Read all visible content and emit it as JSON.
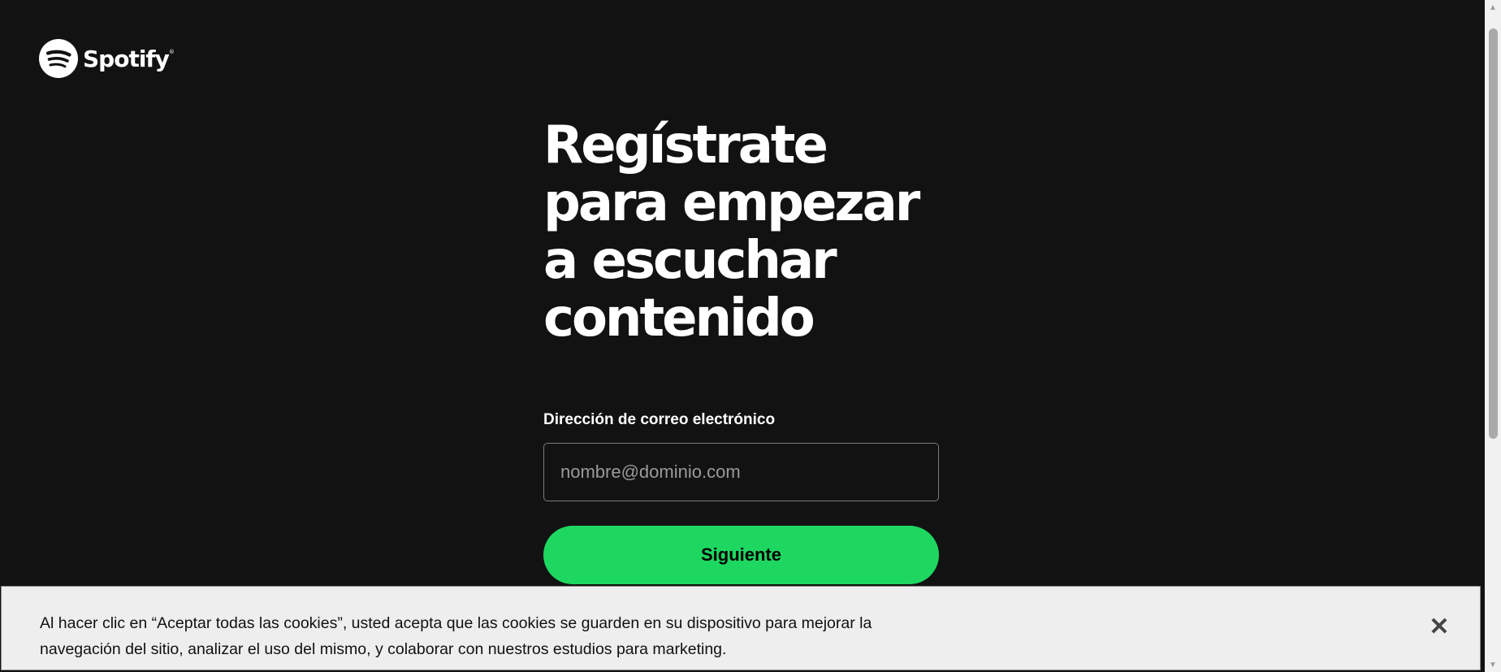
{
  "header": {
    "brand": "Spotify",
    "trademark": "®",
    "logo_icon": "spotify-logo-icon"
  },
  "signup": {
    "headline": "Regístrate para empezar a escuchar contenido",
    "email_label": "Dirección de correo electrónico",
    "email_placeholder": "nombre@dominio.com",
    "email_value": "",
    "next_label": "Siguiente"
  },
  "cookie_banner": {
    "text": "Al hacer clic en “Aceptar todas las cookies”, usted acepta que las cookies se guarden en su dispositivo para mejorar la navegación del sitio, analizar el uso del mismo, y colaborar con nuestros estudios para marketing.",
    "close_icon": "close-icon",
    "close_glyph": "✕"
  },
  "scrollbar": {
    "up_glyph": "▲",
    "down_glyph": "▼"
  },
  "colors": {
    "background": "#121212",
    "accent": "#1ed760",
    "text": "#ffffff",
    "banner_background": "#eeeeee"
  }
}
